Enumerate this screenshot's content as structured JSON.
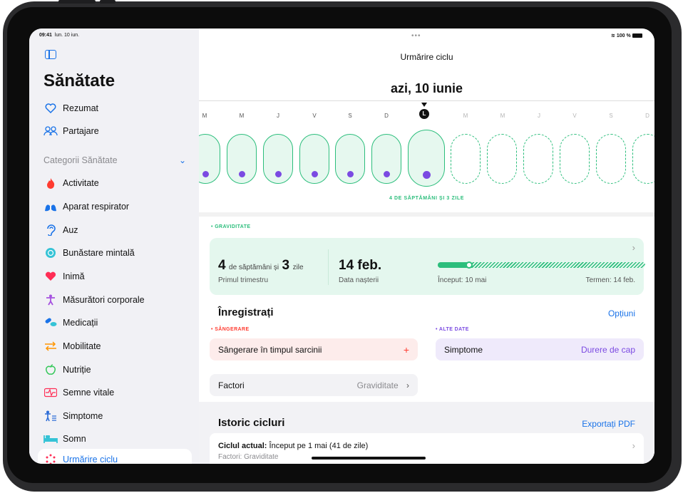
{
  "status": {
    "time": "09:41",
    "date": "lun. 10 iun.",
    "battery": "100 %"
  },
  "sidebar": {
    "title": "Sănătate",
    "items_top": [
      {
        "label": "Rezumat",
        "icon": "heart-outline-icon"
      },
      {
        "label": "Partajare",
        "icon": "people-icon"
      }
    ],
    "categories_label": "Categorii Sănătate",
    "categories": [
      {
        "label": "Activitate",
        "icon": "flame-icon",
        "color": "#ff3b30"
      },
      {
        "label": "Aparat respirator",
        "icon": "lungs-icon",
        "color": "#1a73e8"
      },
      {
        "label": "Auz",
        "icon": "ear-icon",
        "color": "#1a73e8"
      },
      {
        "label": "Bunăstare mintală",
        "icon": "brain-icon",
        "color": "#35c3d6"
      },
      {
        "label": "Inimă",
        "icon": "heart-icon",
        "color": "#ff2d55"
      },
      {
        "label": "Măsurători corporale",
        "icon": "figure-icon",
        "color": "#a652e0"
      },
      {
        "label": "Medicații",
        "icon": "pills-icon",
        "color": "#1a73e8"
      },
      {
        "label": "Mobilitate",
        "icon": "arrows-icon",
        "color": "#ff9500"
      },
      {
        "label": "Nutriție",
        "icon": "apple-icon",
        "color": "#34c759"
      },
      {
        "label": "Semne vitale",
        "icon": "waveform-icon",
        "color": "#ff2d55"
      },
      {
        "label": "Simptome",
        "icon": "figure-list-icon",
        "color": "#2b6bd6"
      },
      {
        "label": "Somn",
        "icon": "bed-icon",
        "color": "#35c3d6"
      },
      {
        "label": "Urmărire ciclu",
        "icon": "dots-circle-icon",
        "color": "#ff2d55"
      }
    ]
  },
  "main": {
    "nav_title": "Urmărire ciclu",
    "today_label": "azi, 10 iunie",
    "day_letters": [
      "M",
      "M",
      "J",
      "V",
      "S",
      "D",
      "L",
      "M",
      "M",
      "J",
      "V",
      "S",
      "D"
    ],
    "today_letter": "L",
    "weeks_label": "4 DE SĂPTĂMÂNI ȘI 3 ZILE",
    "pregnancy": {
      "tag": "• GRAVIDITATE",
      "weeks_num": "4",
      "weeks_text": "de săptămâni și",
      "days_num": "3",
      "days_text": "zile",
      "trimester": "Primul trimestru",
      "due_date": "14 feb.",
      "due_label": "Data nașterii",
      "start_label": "Început: 10 mai",
      "term_label": "Termen: 14 feb.",
      "progress": 0.15
    },
    "log": {
      "title": "Înregistrați",
      "options": "Opțiuni",
      "bleeding_tag": "• SÂNGERARE",
      "bleeding_label": "Sângerare în timpul sarcinii",
      "bleeding_add": "+",
      "other_tag": "• ALTE DATE",
      "symptoms_label": "Simptome",
      "symptoms_value": "Durere de cap",
      "factors_label": "Factori",
      "factors_value": "Graviditate"
    },
    "history": {
      "title": "Istoric cicluri",
      "export": "Exportați PDF",
      "current_bold": "Ciclul actual:",
      "current_text": "Început pe 1 mai (41 de zile)",
      "factors_line": "Factori: Graviditate"
    }
  },
  "colors": {
    "accent": "#1a73e8",
    "green": "#2cbe7c",
    "purple": "#7b4ae2",
    "red": "#ff3b30"
  }
}
